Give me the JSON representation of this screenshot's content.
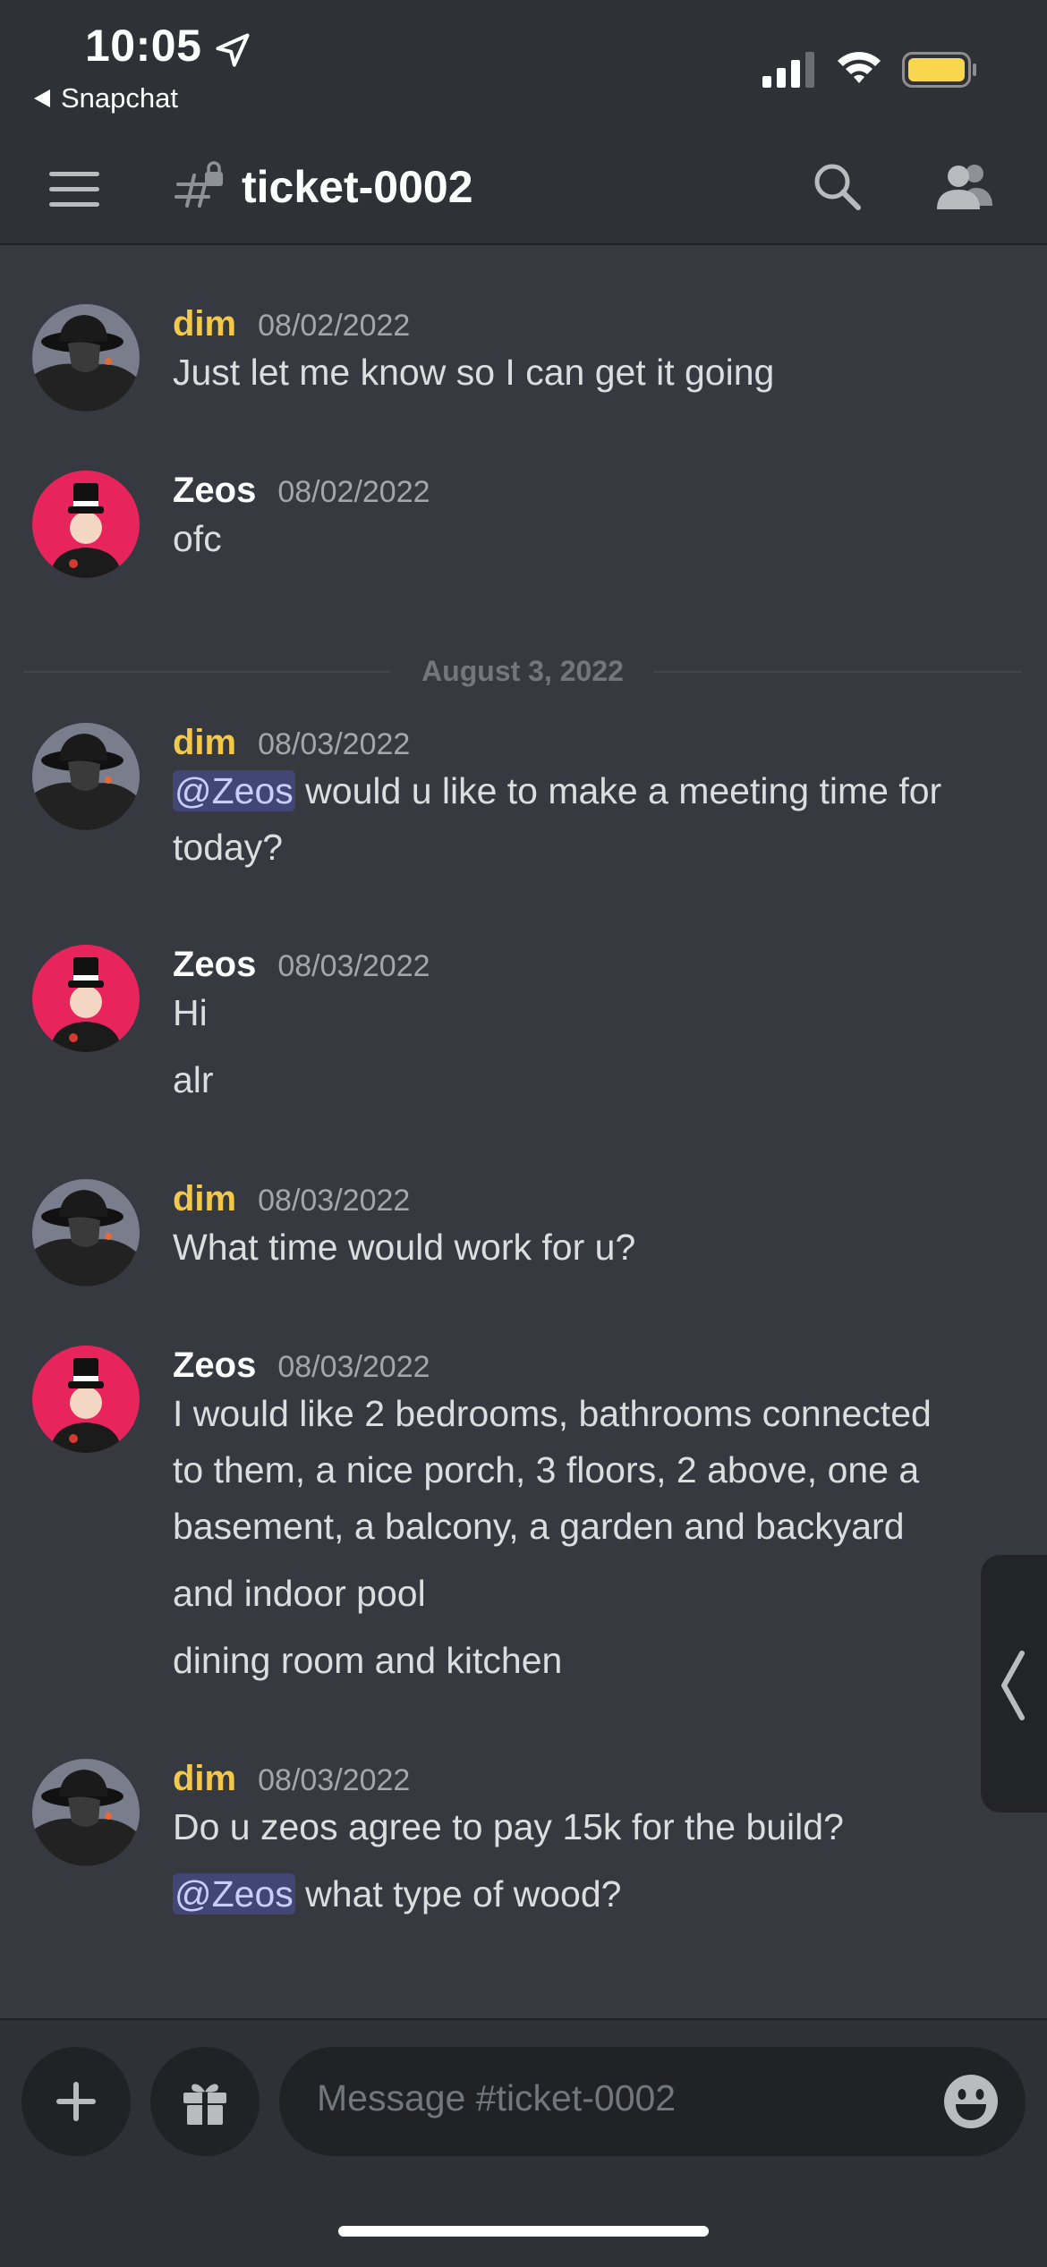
{
  "status_bar": {
    "time": "10:05",
    "back_app": "Snapchat",
    "battery_color": "#f8d64e"
  },
  "header": {
    "channel": "ticket-0002",
    "icons": [
      "menu-icon",
      "locked-channel-icon",
      "search-icon",
      "members-icon"
    ]
  },
  "divider_label": "August 3, 2022",
  "messages": [
    {
      "author": "dim",
      "timestamp": "08/02/2022",
      "lines": [
        "Just let me know so I can get it going"
      ]
    },
    {
      "author": "Zeos",
      "timestamp": "08/02/2022",
      "lines": [
        "ofc"
      ]
    },
    {
      "author": "dim",
      "timestamp": "08/03/2022",
      "mention": "@Zeos",
      "lines": [
        " would u like to make a meeting time for",
        "today?"
      ]
    },
    {
      "author": "Zeos",
      "timestamp": "08/03/2022",
      "lines": [
        "Hi",
        "alr"
      ]
    },
    {
      "author": "dim",
      "timestamp": "08/03/2022",
      "lines": [
        "What time would work for u?"
      ]
    },
    {
      "author": "Zeos",
      "timestamp": "08/03/2022",
      "lines": [
        "I would like 2 bedrooms, bathrooms connected",
        "to them, a nice porch, 3 floors, 2 above, one a",
        "basement, a balcony, a garden and backyard",
        "and indoor pool",
        "dining room and kitchen"
      ]
    },
    {
      "author": "dim",
      "timestamp": "08/03/2022",
      "mention": "@Zeos",
      "lines": [
        "Do u zeos agree to pay 15k for the build?",
        " what type of wood?"
      ]
    }
  ],
  "composer": {
    "placeholder": "Message #ticket-0002"
  },
  "colors": {
    "background": "#36393f",
    "header": "#2f3136",
    "dim_name": "#f2c94c",
    "mention_bg": "#414675"
  }
}
